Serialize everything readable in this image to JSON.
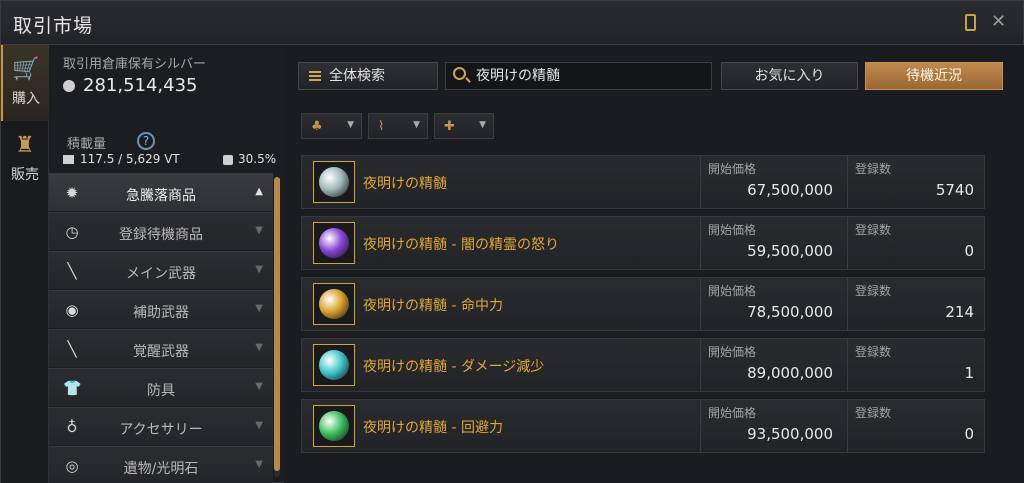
{
  "window": {
    "title": "取引市場",
    "close_glyph": "✕"
  },
  "rail": {
    "buy_label": "購入",
    "sell_label": "販売"
  },
  "info": {
    "silver_label": "取引用倉庫保有シルバー",
    "silver_value": "281,514,435",
    "weight_label": "積載量",
    "help_glyph": "?",
    "weight_value": "117.5 / 5,629 VT",
    "percent": "30.5%"
  },
  "categories": [
    {
      "label": "急騰落商品",
      "icon": "gear-icon",
      "glyph": "✹",
      "arrow": "▲",
      "active": true
    },
    {
      "label": "登録待機商品",
      "icon": "clock-icon",
      "glyph": "◷",
      "arrow": "▼"
    },
    {
      "label": "メイン武器",
      "icon": "sword-icon",
      "glyph": "╲",
      "arrow": "▼"
    },
    {
      "label": "補助武器",
      "icon": "shield-icon",
      "glyph": "◉",
      "arrow": "▼"
    },
    {
      "label": "覚醒武器",
      "icon": "blade-icon",
      "glyph": "╲",
      "arrow": "▼"
    },
    {
      "label": "防具",
      "icon": "armor-icon",
      "glyph": "👕",
      "arrow": "▼"
    },
    {
      "label": "アクセサリー",
      "icon": "ring-icon",
      "glyph": "♁",
      "arrow": "▼"
    },
    {
      "label": "遺物/光明石",
      "icon": "relic-icon",
      "glyph": "◎",
      "arrow": "▼"
    }
  ],
  "toolbar": {
    "all_search_label": "全体検索",
    "search_value": "夜明けの精髄",
    "favorites_label": "お気に入り",
    "waiting_label": "待機近況"
  },
  "filters": [
    {
      "icon": "moneybag-icon",
      "glyph": "♣",
      "arrow": "▼"
    },
    {
      "icon": "trend-icon",
      "glyph": "⌇",
      "arrow": "▼"
    },
    {
      "icon": "plus-icon",
      "glyph": "✚",
      "arrow": "▼"
    }
  ],
  "items_header": {
    "price_label": "開始価格",
    "count_label": "登録数"
  },
  "items": [
    {
      "name": "夜明けの精髄",
      "price": "67,500,000",
      "count": "5740",
      "orb_color": "#9fb7b8"
    },
    {
      "name": "夜明けの精髄 - 闇の精霊の怒り",
      "price": "59,500,000",
      "count": "0",
      "orb_color": "#8a45d6"
    },
    {
      "name": "夜明けの精髄 - 命中力",
      "price": "78,500,000",
      "count": "214",
      "orb_color": "#d8a22c"
    },
    {
      "name": "夜明けの精髄 - ダメージ減少",
      "price": "89,000,000",
      "count": "1",
      "orb_color": "#3fc7c9"
    },
    {
      "name": "夜明けの精髄 - 回避力",
      "price": "93,500,000",
      "count": "0",
      "orb_color": "#3fbf5e"
    }
  ]
}
